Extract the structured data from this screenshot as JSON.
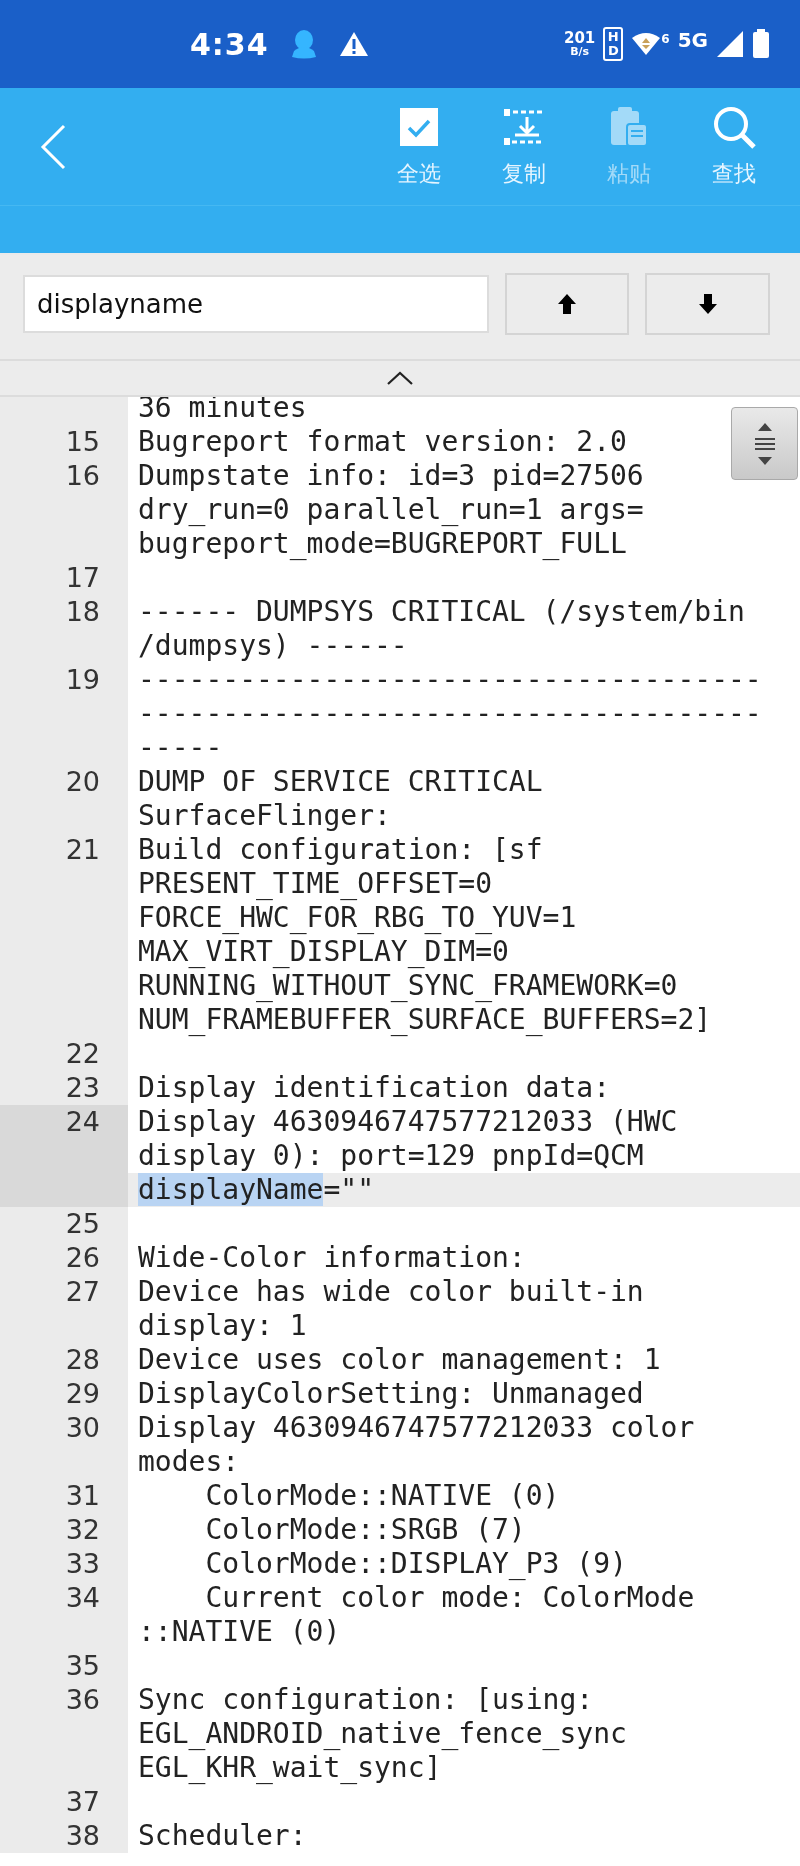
{
  "status_bar": {
    "time": "4:34",
    "net_speed": "201",
    "net_unit": "B/s",
    "hd_badge": "HD",
    "wifi_badge": "6",
    "network": "5G"
  },
  "toolbar": {
    "actions": [
      {
        "kind": "select-all",
        "label": "全选",
        "disabled": false
      },
      {
        "kind": "copy",
        "label": "复制",
        "disabled": false
      },
      {
        "kind": "paste",
        "label": "粘贴",
        "disabled": true
      },
      {
        "kind": "find",
        "label": "查找",
        "disabled": false
      }
    ]
  },
  "search": {
    "value": "displayname"
  },
  "editor": {
    "lines": [
      {
        "segments": [
          "36 minutes"
        ]
      },
      {
        "number": "15",
        "segments": [
          "Bugreport format version: 2.0"
        ]
      },
      {
        "number": "16",
        "segments": [
          "Dumpstate info: id=3 pid=27506",
          "dry_run=0 parallel_run=1 args=",
          "bugreport_mode=BUGREPORT_FULL"
        ]
      },
      {
        "number": "17"
      },
      {
        "number": "18",
        "segments": [
          "------ DUMPSYS CRITICAL (/system/bin",
          "/dumpsys) ------"
        ]
      },
      {
        "number": "19",
        "segments": [
          "-------------------------------------",
          "-------------------------------------",
          "-----"
        ]
      },
      {
        "number": "20",
        "segments": [
          "DUMP OF SERVICE CRITICAL",
          "SurfaceFlinger:"
        ]
      },
      {
        "number": "21",
        "segments": [
          "Build configuration: [sf",
          "PRESENT_TIME_OFFSET=0",
          "FORCE_HWC_FOR_RBG_TO_YUV=1",
          "MAX_VIRT_DISPLAY_DIM=0",
          "RUNNING_WITHOUT_SYNC_FRAMEWORK=0",
          "NUM_FRAMEBUFFER_SURFACE_BUFFERS=2]"
        ]
      },
      {
        "number": "22"
      },
      {
        "number": "23",
        "segments": [
          "Display identification data:"
        ]
      },
      {
        "number": "24",
        "current": true,
        "segments": [
          "Display 4630946747577212033 (HWC",
          "display 0): port=129 pnpId=QCM",
          {
            "cursor": true,
            "parts": [
              {
                "text": "displayName",
                "selected": true
              },
              {
                "text": "=\"\"",
                "selected": false
              }
            ]
          }
        ]
      },
      {
        "number": "25"
      },
      {
        "number": "26",
        "segments": [
          "Wide-Color information:"
        ]
      },
      {
        "number": "27",
        "segments": [
          "Device has wide color built-in",
          "display: 1"
        ]
      },
      {
        "number": "28",
        "segments": [
          "Device uses color management: 1"
        ]
      },
      {
        "number": "29",
        "segments": [
          "DisplayColorSetting: Unmanaged"
        ]
      },
      {
        "number": "30",
        "segments": [
          "Display 4630946747577212033 color",
          "modes:"
        ]
      },
      {
        "number": "31",
        "segments": [
          "    ColorMode::NATIVE (0)"
        ]
      },
      {
        "number": "32",
        "segments": [
          "    ColorMode::SRGB (7)"
        ]
      },
      {
        "number": "33",
        "segments": [
          "    ColorMode::DISPLAY_P3 (9)"
        ]
      },
      {
        "number": "34",
        "segments": [
          "    Current color mode: ColorMode",
          "::NATIVE (0)"
        ]
      },
      {
        "number": "35"
      },
      {
        "number": "36",
        "segments": [
          "Sync configuration: [using:",
          "EGL_ANDROID_native_fence_sync",
          "EGL_KHR_wait_sync]"
        ]
      },
      {
        "number": "37"
      },
      {
        "number": "38",
        "segments": [
          "Scheduler:"
        ]
      }
    ]
  }
}
